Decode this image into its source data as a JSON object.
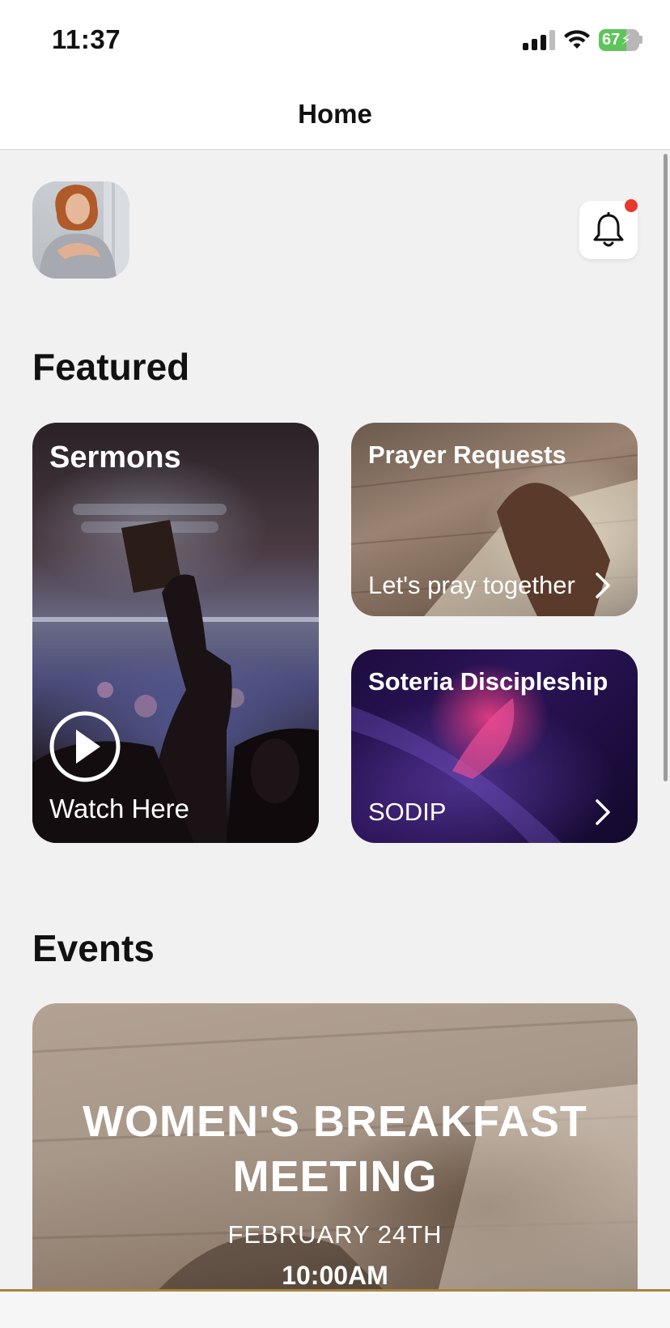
{
  "status_bar": {
    "time": "11:37",
    "battery": "67",
    "battery_level_percent": 67
  },
  "nav": {
    "title": "Home"
  },
  "header": {
    "avatar": "profile-avatar",
    "notification_icon": "bell-icon",
    "has_unread": true,
    "unread_color": "#e8392e"
  },
  "featured": {
    "title": "Featured",
    "cards": [
      {
        "title": "Sermons",
        "subtitle": "Watch Here",
        "icon": "play-circle-icon"
      },
      {
        "title": "Prayer Requests",
        "subtitle": "Let's pray together",
        "icon": "chevron-right-icon"
      },
      {
        "title": "Soteria Discipleship",
        "subtitle": "SODIP",
        "icon": "chevron-right-icon"
      }
    ]
  },
  "events": {
    "title": "Events",
    "items": [
      {
        "title": "WOMEN'S BREAKFAST MEETING",
        "date": "FEBRUARY 24TH",
        "time": "10:00AM"
      }
    ]
  },
  "colors": {
    "accent": "#a8823e",
    "background": "#f1f1f2"
  }
}
